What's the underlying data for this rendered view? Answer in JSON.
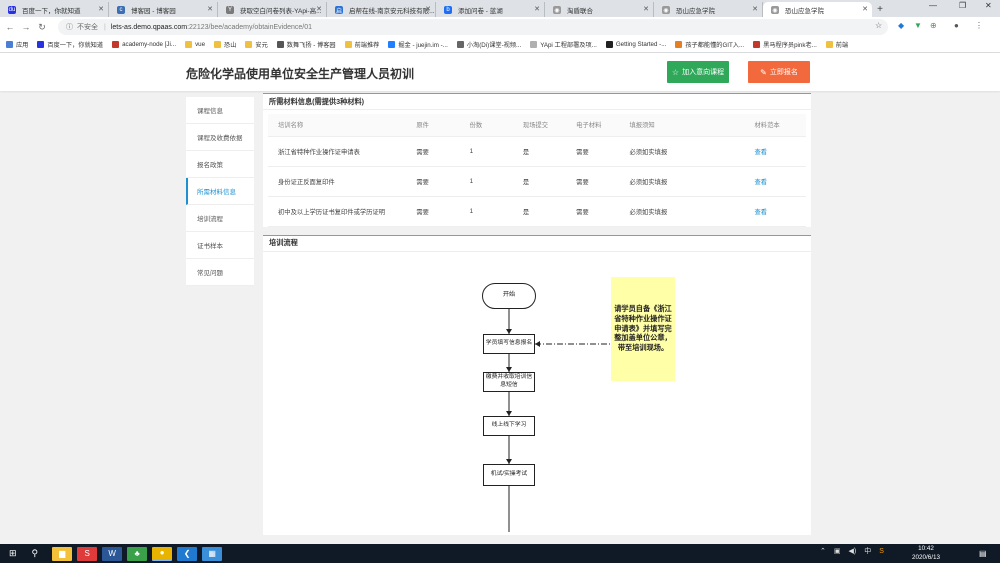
{
  "browser": {
    "tabs": [
      {
        "label": "百度一下，你就知道",
        "color": "#2932e1",
        "glyph": "du",
        "active": false
      },
      {
        "label": "博客园 - 博客园",
        "color": "#3a6fb5",
        "glyph": "c",
        "active": false
      },
      {
        "label": "获取空白问卷列表-YApi-高...",
        "color": "#7a7a7a",
        "glyph": "Y",
        "active": false
      },
      {
        "label": "启帮在线-南京安元科技有限...",
        "color": "#2a73d6",
        "glyph": "启",
        "active": false
      },
      {
        "label": "添加问卷 - 蓝湖",
        "color": "#1d6ef2",
        "glyph": "b",
        "active": false
      },
      {
        "label": "淘盾联合",
        "color": "#999999",
        "glyph": "◉",
        "active": false
      },
      {
        "label": "恐山应急学院",
        "color": "#999999",
        "glyph": "◉",
        "active": false
      },
      {
        "label": "恐山应急学院",
        "color": "#999999",
        "glyph": "◉",
        "active": true
      }
    ],
    "address": {
      "security": "不安全",
      "host": "lets-as.demo.qpaas.com",
      "path": ":22123/bee/academy/obtainEvidence/01"
    },
    "bookmarks": [
      {
        "label": "应用",
        "color": "#4a7fd6"
      },
      {
        "label": "百度一下，你就知道",
        "color": "#2932e1"
      },
      {
        "label": "academy-node [Ji...",
        "color": "#c0392b"
      },
      {
        "label": "vue",
        "color": "#f0c040"
      },
      {
        "label": "恐山",
        "color": "#f0c040"
      },
      {
        "label": "安元",
        "color": "#f0c040"
      },
      {
        "label": "数舞飞扬 - 博客园",
        "color": "#555555"
      },
      {
        "label": "前端推荐",
        "color": "#f0c040"
      },
      {
        "label": "掘金 - juejin.im -...",
        "color": "#1e80ff"
      },
      {
        "label": "小淘(Di)课堂-视频...",
        "color": "#666666"
      },
      {
        "label": "YApi 工程部署及项...",
        "color": "#b0b0b0"
      },
      {
        "label": "Getting Started -...",
        "color": "#222222"
      },
      {
        "label": "孩子都能懂的GIT入...",
        "color": "#e67e22"
      },
      {
        "label": "黑马程序员pink老...",
        "color": "#c0392b"
      },
      {
        "label": "前端",
        "color": "#f0c040"
      }
    ]
  },
  "header": {
    "title": "危险化学品使用单位安全生产管理人员初训",
    "join_label": "加入意向课程",
    "apply_label": "立即报名"
  },
  "sidebar": {
    "items": [
      {
        "label": "课程信息",
        "active": false
      },
      {
        "label": "课程及收费依据",
        "active": false
      },
      {
        "label": "报名政策",
        "active": false
      },
      {
        "label": "所需材料信息",
        "active": true
      },
      {
        "label": "培训流程",
        "active": false
      },
      {
        "label": "证书样本",
        "active": false
      },
      {
        "label": "常见问题",
        "active": false
      }
    ]
  },
  "materials": {
    "title": "所需材料信息(需提供3种材料)",
    "columns": [
      "培训名称",
      "原件",
      "份数",
      "现场提交",
      "电子材料",
      "填报须知",
      "材料范本"
    ],
    "rows": [
      [
        "浙江省特种作业操作证申请表",
        "需要",
        "1",
        "是",
        "需要",
        "必须如实填报",
        "查看"
      ],
      [
        "身份证正反面复印件",
        "需要",
        "1",
        "是",
        "需要",
        "必须如实填报",
        "查看"
      ],
      [
        "初中及以上学历证书复印件或学历证明",
        "需要",
        "1",
        "是",
        "需要",
        "必须如实填报",
        "查看"
      ]
    ]
  },
  "flow": {
    "title": "培训流程",
    "start": "开始",
    "steps": [
      "学员填写信息报名",
      "缴费并收取培训信息短信",
      "线上线下学习",
      "机试/实操考试"
    ],
    "note": "请学员自备《浙江省特种作业操作证申请表》并填写完整加盖单位公章，带至培训现场。"
  },
  "taskbar": {
    "time": "10:42",
    "date": "2020/6/13",
    "ime": "中",
    "apps": [
      {
        "name": "file-explorer-icon",
        "color": "#f3c23a",
        "glyph": "▆"
      },
      {
        "name": "sogou-icon",
        "color": "#e03b3b",
        "glyph": "S"
      },
      {
        "name": "word-icon",
        "color": "#2b5797",
        "glyph": "W"
      },
      {
        "name": "game-icon",
        "color": "#3aa04a",
        "glyph": "♣"
      },
      {
        "name": "chrome-icon",
        "color": "#e8b400",
        "glyph": "●"
      },
      {
        "name": "vscode-icon",
        "color": "#1f7ad0",
        "glyph": "❮"
      },
      {
        "name": "app-icon",
        "color": "#3b8fd8",
        "glyph": "▦"
      }
    ]
  }
}
